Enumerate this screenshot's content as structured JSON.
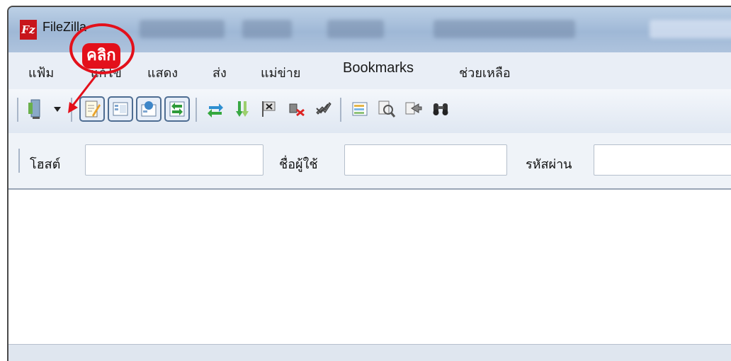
{
  "window": {
    "title": "FileZilla",
    "app_icon_letter": "Fz"
  },
  "menubar": {
    "items": [
      {
        "label": "แฟ้ม"
      },
      {
        "label": "แก้ไข"
      },
      {
        "label": "แสดง"
      },
      {
        "label": "ส่ง"
      },
      {
        "label": "แม่ข่าย"
      },
      {
        "label": "Bookmarks"
      },
      {
        "label": "ช่วยเหลือ"
      }
    ]
  },
  "toolbar": {
    "buttons": [
      {
        "icon": "site-manager-icon"
      },
      {
        "icon": "dropdown-arrow-icon"
      },
      {
        "icon": "message-log-icon",
        "pressed": true
      },
      {
        "icon": "local-tree-icon",
        "pressed": true
      },
      {
        "icon": "remote-tree-icon",
        "pressed": true
      },
      {
        "icon": "transfer-queue-icon",
        "pressed": true
      },
      {
        "icon": "refresh-icon"
      },
      {
        "icon": "process-queue-icon"
      },
      {
        "icon": "cancel-icon"
      },
      {
        "icon": "disconnect-icon"
      },
      {
        "icon": "reconnect-icon"
      },
      {
        "icon": "directory-filter-icon"
      },
      {
        "icon": "dir-compare-icon"
      },
      {
        "icon": "sync-browse-icon"
      },
      {
        "icon": "search-binoculars-icon"
      }
    ]
  },
  "quickconnect": {
    "host_label": "โฮสต์",
    "host_value": "",
    "user_label": "ชื่อผู้ใช้",
    "user_value": "",
    "pass_label": "รหัสผ่าน",
    "pass_value": ""
  },
  "annotation": {
    "label": "คลิก",
    "color": "#e3101b"
  }
}
